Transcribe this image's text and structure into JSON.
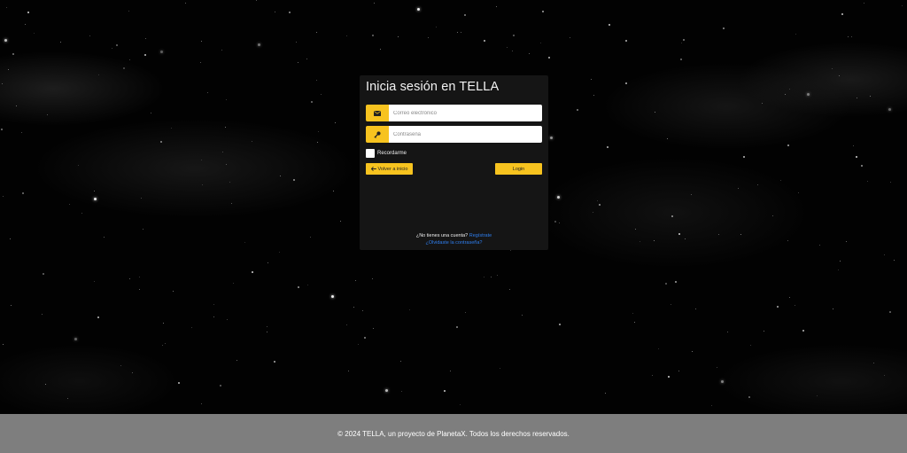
{
  "login": {
    "title": "Inicia sesión en TELLA",
    "email_placeholder": "Correo electrónico",
    "password_placeholder": "Contraseña",
    "remember_label": "Recordarme",
    "back_label": "Volver a inicio",
    "login_label": "Login",
    "no_account_text": "¿No tienes una cuenta?",
    "register_link": "Regístrate",
    "forgot_link": "¿Olvidaste la contraseña?"
  },
  "footer": {
    "text": "© 2024 TELLA, un proyecto de PlanetaX. Todos los derechos reservados."
  },
  "colors": {
    "accent": "#f7c31f",
    "link": "#2f7ff0",
    "card": "#151515",
    "footer": "#7e7e7e"
  },
  "icons": {
    "email": "envelope-icon",
    "password": "key-icon",
    "back": "arrow-left-icon"
  }
}
